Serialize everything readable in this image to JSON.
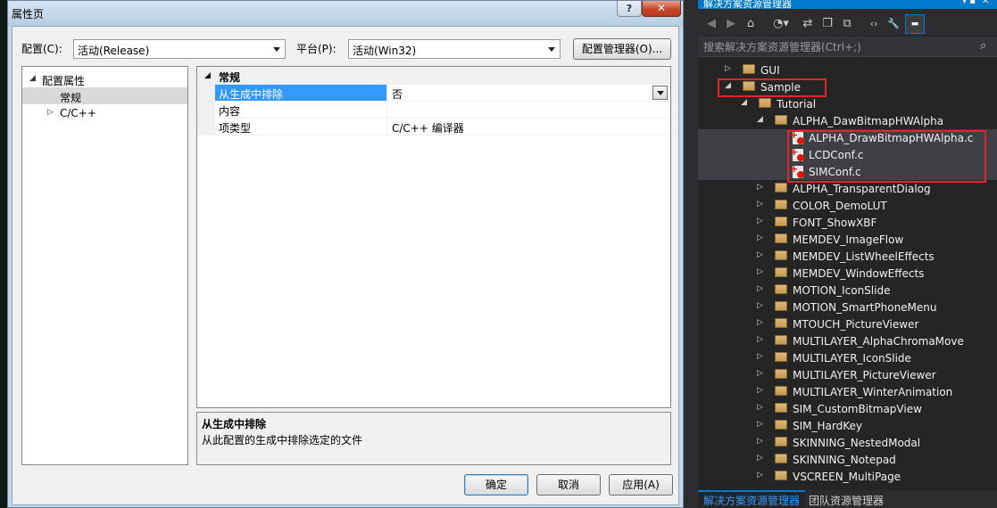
{
  "dialog": {
    "title": "属性页",
    "help_glyph": "?",
    "close_glyph": "✕",
    "config_label": "配置(C):",
    "config_value": "活动(Release)",
    "platform_label": "平台(P):",
    "platform_value": "活动(Win32)",
    "config_manager_button": "配置管理器(O)...",
    "tree": [
      {
        "expander": "◢",
        "label": "配置属性"
      },
      {
        "expander": "",
        "label": "常规"
      },
      {
        "expander": "▷",
        "label": "C/C++"
      }
    ],
    "grid": {
      "category_expander": "◢",
      "category": "常规",
      "rows": [
        {
          "name": "从生成中排除",
          "value": "否"
        },
        {
          "name": "内容",
          "value": ""
        },
        {
          "name": "项类型",
          "value": "C/C++ 编译器"
        }
      ]
    },
    "description": {
      "title": "从生成中排除",
      "text": "从此配置的生成中排除选定的文件"
    },
    "buttons": {
      "ok": "确定",
      "cancel": "取消",
      "apply": "应用(A)"
    }
  },
  "solution_explorer": {
    "title": "解决方案资源管理器",
    "pin_glyph": "▾ ▪",
    "close_glyph": "✕",
    "toolbar_icons": [
      "back-icon",
      "forward-icon",
      "home-icon",
      "history-icon",
      "sync-icon",
      "collapse-all-icon",
      "show-all-files-icon",
      "view-code-icon",
      "properties-icon",
      "preview-icon"
    ],
    "toolbar_glyphs": [
      "◀",
      "▶",
      "⌂",
      "◔▾",
      "⇄",
      "❐",
      "⧉",
      "‹›",
      "🔧",
      "▬"
    ],
    "search_placeholder": "搜索解决方案资源管理器(Ctrl+;)",
    "search_glyph": "⌕",
    "tree": [
      {
        "expander": "▷",
        "label": "GUI",
        "icon": "folder"
      },
      {
        "expander": "◢",
        "label": "Sample",
        "icon": "folder"
      },
      {
        "expander": "◢",
        "label": "Tutorial",
        "icon": "folder"
      },
      {
        "expander": "◢",
        "label": "ALPHA_DawBitmapHWAlpha",
        "icon": "folder"
      },
      {
        "expander": "",
        "label": "ALPHA_DrawBitmapHWAlpha.c",
        "icon": "excluded-c-file"
      },
      {
        "expander": "",
        "label": "LCDConf.c",
        "icon": "excluded-c-file"
      },
      {
        "expander": "",
        "label": "SIMConf.c",
        "icon": "excluded-c-file"
      },
      {
        "expander": "▷",
        "label": "ALPHA_TransparentDialog",
        "icon": "folder"
      },
      {
        "expander": "▷",
        "label": "COLOR_DemoLUT",
        "icon": "folder"
      },
      {
        "expander": "▷",
        "label": "FONT_ShowXBF",
        "icon": "folder"
      },
      {
        "expander": "▷",
        "label": "MEMDEV_ImageFlow",
        "icon": "folder"
      },
      {
        "expander": "▷",
        "label": "MEMDEV_ListWheelEffects",
        "icon": "folder"
      },
      {
        "expander": "▷",
        "label": "MEMDEV_WindowEffects",
        "icon": "folder"
      },
      {
        "expander": "▷",
        "label": "MOTION_IconSlide",
        "icon": "folder"
      },
      {
        "expander": "▷",
        "label": "MOTION_SmartPhoneMenu",
        "icon": "folder"
      },
      {
        "expander": "▷",
        "label": "MTOUCH_PictureViewer",
        "icon": "folder"
      },
      {
        "expander": "▷",
        "label": "MULTILAYER_AlphaChromaMove",
        "icon": "folder"
      },
      {
        "expander": "▷",
        "label": "MULTILAYER_IconSlide",
        "icon": "folder"
      },
      {
        "expander": "▷",
        "label": "MULTILAYER_PictureViewer",
        "icon": "folder"
      },
      {
        "expander": "▷",
        "label": "MULTILAYER_WinterAnimation",
        "icon": "folder"
      },
      {
        "expander": "▷",
        "label": "SIM_CustomBitmapView",
        "icon": "folder"
      },
      {
        "expander": "▷",
        "label": "SIM_HardKey",
        "icon": "folder"
      },
      {
        "expander": "▷",
        "label": "SKINNING_NestedModal",
        "icon": "folder"
      },
      {
        "expander": "▷",
        "label": "SKINNING_Notepad",
        "icon": "folder"
      },
      {
        "expander": "▷",
        "label": "VSCREEN_MultiPage",
        "icon": "folder"
      }
    ],
    "tabs": [
      "解决方案资源管理器",
      "团队资源管理器"
    ]
  },
  "colors": {
    "accent": "#007acc",
    "highlight_box": "#e0262b",
    "selection_blue": "#3399ff"
  }
}
